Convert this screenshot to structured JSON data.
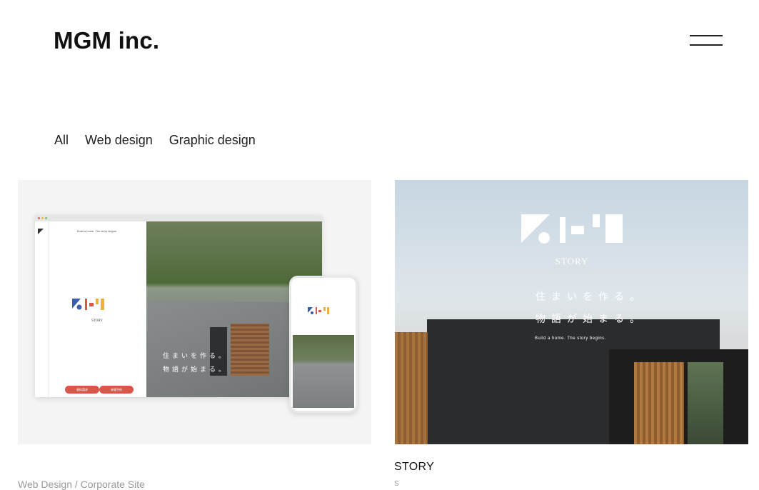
{
  "header": {
    "logo": "MGM inc."
  },
  "filters": [
    {
      "label": "All"
    },
    {
      "label": "Web design"
    },
    {
      "label": "Graphic design"
    }
  ],
  "works": [
    {
      "meta": "Web Design / Corporate Site",
      "mock": {
        "tagline": "Build a home. The story begins.",
        "jp_line1": "住まいを作る。",
        "jp_line2": "物語が始まる。",
        "brand": "STORY",
        "btn1": "資料請求",
        "btn2": "来場予約"
      }
    },
    {
      "title": "STORY",
      "meta": "S",
      "hero": {
        "brand": "STORY",
        "jp_line1": "住まいを作る。",
        "jp_line2": "物語が始まる。",
        "tagline": "Build a home. The story begins."
      }
    }
  ],
  "colors": {
    "accent_blue": "#3b5ea8",
    "accent_red": "#d9574a",
    "accent_yellow": "#e8b53a"
  }
}
